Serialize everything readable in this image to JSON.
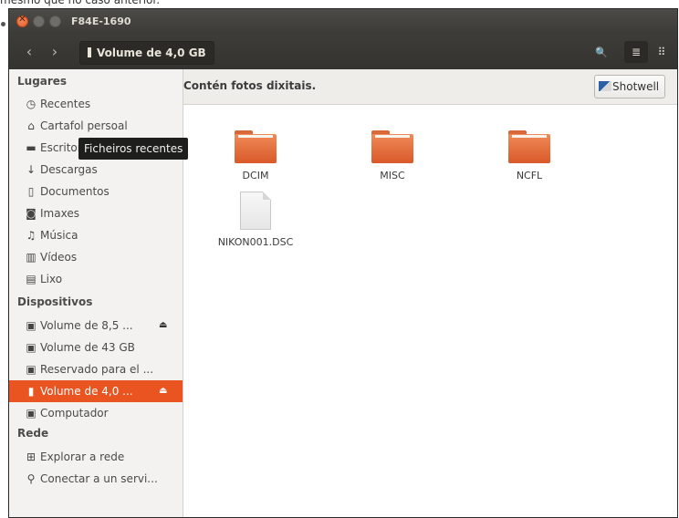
{
  "caption": "mesmo que no caso anterior.",
  "window": {
    "title": "F84E-1690",
    "close_glyph": "✕"
  },
  "toolbar": {
    "path_label": "Volume de 4,0 GB",
    "back_glyph": "‹",
    "forward_glyph": "›",
    "search_glyph": "🔍",
    "list_glyph": "≣",
    "grid_glyph": "⠿"
  },
  "sidebar": {
    "places_heading": "Lugares",
    "places": [
      {
        "label": "Recentes",
        "icon": "clock-icon",
        "glyph": "◷"
      },
      {
        "label": "Cartafol persoal",
        "icon": "home-icon",
        "glyph": "⌂"
      },
      {
        "label": "Escritorio",
        "icon": "folder-icon",
        "glyph": "▬"
      },
      {
        "label": "Descargas",
        "icon": "download-icon",
        "glyph": "↓"
      },
      {
        "label": "Documentos",
        "icon": "document-icon",
        "glyph": "▯"
      },
      {
        "label": "Imaxes",
        "icon": "camera-icon",
        "glyph": "◙"
      },
      {
        "label": "Música",
        "icon": "music-icon",
        "glyph": "♫"
      },
      {
        "label": "Vídeos",
        "icon": "video-icon",
        "glyph": "▥"
      },
      {
        "label": "Lixo",
        "icon": "trash-icon",
        "glyph": "▤"
      }
    ],
    "devices_heading": "Dispositivos",
    "devices": [
      {
        "label": "Volume de 8,5 ...",
        "icon": "drive-icon",
        "glyph": "▣",
        "eject": "⏏"
      },
      {
        "label": "Volume de 43 GB",
        "icon": "drive-icon",
        "glyph": "▣"
      },
      {
        "label": "Reservado para el ...",
        "icon": "drive-icon",
        "glyph": "▣"
      },
      {
        "label": "Volume de 4,0 ...",
        "icon": "usb-icon",
        "glyph": "▮",
        "eject": "⏏",
        "selected": true
      },
      {
        "label": "Computador",
        "icon": "drive-icon",
        "glyph": "▣"
      }
    ],
    "network_heading": "Rede",
    "network": [
      {
        "label": "Explorar a rede",
        "icon": "network-icon",
        "glyph": "⊞"
      },
      {
        "label": "Conectar a un servi...",
        "icon": "server-icon",
        "glyph": "⚲"
      }
    ]
  },
  "tooltip": "Ficheiros recentes",
  "infobar": {
    "text": "Contén fotos dixitais.",
    "button_label": "Shotwell"
  },
  "files": [
    {
      "name": "DCIM",
      "type": "folder"
    },
    {
      "name": "MISC",
      "type": "folder"
    },
    {
      "name": "NCFL",
      "type": "folder"
    },
    {
      "name": "NIKON001.DSC",
      "type": "document"
    }
  ],
  "colors": {
    "accent": "#e95420",
    "titlebar": "#3c3b37",
    "sidebar": "#f3f2f0",
    "folder": "#e9703e"
  }
}
